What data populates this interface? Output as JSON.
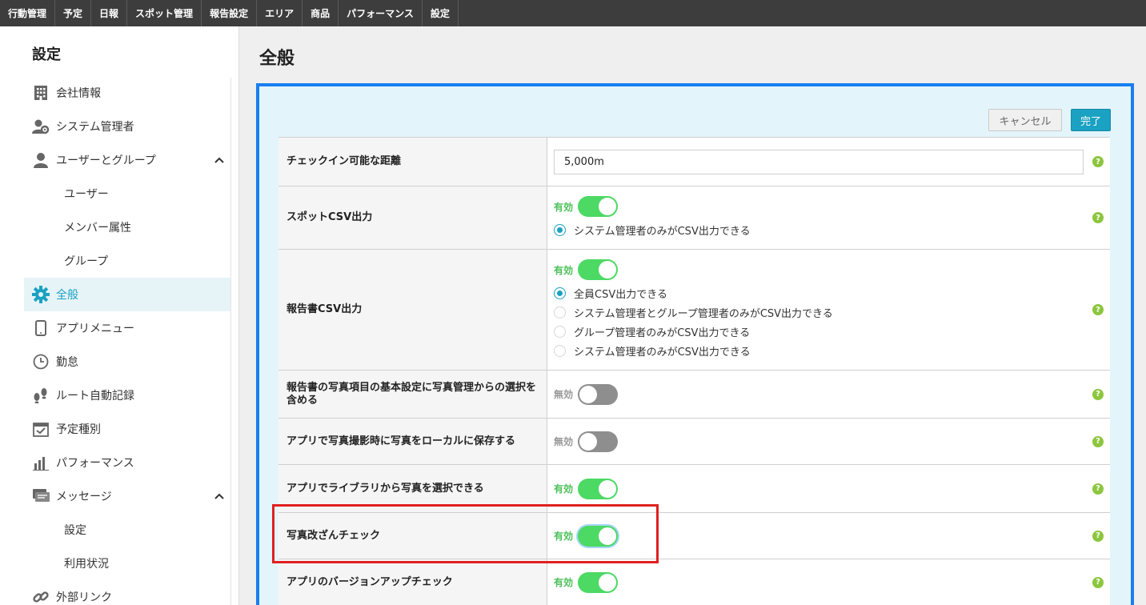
{
  "topnav": {
    "tabs": [
      "行動管理",
      "予定",
      "日報",
      "スポット管理",
      "報告設定",
      "エリア",
      "商品",
      "パフォーマンス",
      "設定"
    ]
  },
  "sidebar": {
    "title": "設定",
    "items": [
      {
        "label": "会社情報",
        "icon": "building-icon"
      },
      {
        "label": "システム管理者",
        "icon": "admin-user-icon"
      },
      {
        "label": "ユーザーとグループ",
        "icon": "user-icon"
      },
      {
        "label": "ユーザー"
      },
      {
        "label": "メンバー属性"
      },
      {
        "label": "グループ"
      },
      {
        "label": "全般",
        "icon": "gear-icon"
      },
      {
        "label": "アプリメニュー",
        "icon": "phone-icon"
      },
      {
        "label": "勤怠",
        "icon": "clock-icon"
      },
      {
        "label": "ルート自動記録",
        "icon": "footprints-icon"
      },
      {
        "label": "予定種別",
        "icon": "calendar-check-icon"
      },
      {
        "label": "パフォーマンス",
        "icon": "bar-chart-icon"
      },
      {
        "label": "メッセージ",
        "icon": "message-icon"
      },
      {
        "label": "設定"
      },
      {
        "label": "利用状況"
      },
      {
        "label": "外部リンク",
        "icon": "link-icon"
      }
    ]
  },
  "main": {
    "title": "全般",
    "cancel_label": "キャンセル",
    "done_label": "完了",
    "help": "?",
    "on_label": "有効",
    "off_label": "無効",
    "rows": {
      "checkin_distance": {
        "label": "チェックイン可能な距離",
        "value": "5,000m"
      },
      "spot_csv": {
        "label": "スポットCSV出力",
        "enabled": true,
        "options": [
          "システム管理者のみがCSV出力できる"
        ]
      },
      "report_csv": {
        "label": "報告書CSV出力",
        "enabled": true,
        "options": [
          "全員CSV出力できる",
          "システム管理者とグループ管理者のみがCSV出力できる",
          "グループ管理者のみがCSV出力できる",
          "システム管理者のみがCSV出力できる"
        ]
      },
      "photo_default": {
        "label": "報告書の写真項目の基本設定に写真管理からの選択を含める",
        "enabled": false
      },
      "save_local": {
        "label": "アプリで写真撮影時に写真をローカルに保存する",
        "enabled": false
      },
      "library_select": {
        "label": "アプリでライブラリから写真を選択できる",
        "enabled": true
      },
      "tamper_check": {
        "label": "写真改ざんチェック",
        "enabled": true
      },
      "version_check": {
        "label": "アプリのバージョンアップチェック",
        "enabled": true
      }
    }
  },
  "colors": {
    "accent": "#1ba1c2",
    "toggle_on": "#4cd964",
    "panel_border": "#1a7ef0",
    "highlight": "#e02020"
  }
}
